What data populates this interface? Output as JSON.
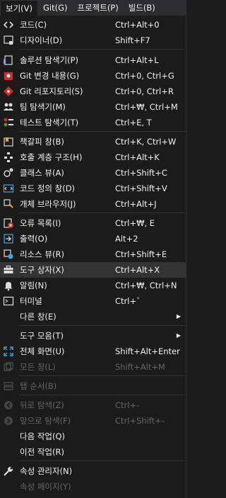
{
  "menubar": [
    "보기(V)",
    "Git(G)",
    "프로젝트(P)",
    "빌드(B)"
  ],
  "items": [
    {
      "label": "코드(C)",
      "shortcut": "Ctrl+Alt+0",
      "icon": "code-icon"
    },
    {
      "label": "디자이너(D)",
      "shortcut": "Shift+F7",
      "icon": "designer-icon"
    },
    {
      "label": "솔루션 탐색기(P)",
      "shortcut": "Ctrl+Alt+L",
      "icon": "solution-explorer-icon"
    },
    {
      "label": "Git 변경 내용(G)",
      "shortcut": "Ctrl+0, Ctrl+G",
      "icon": "git-changes-icon"
    },
    {
      "label": "Git 리포지토리(S)",
      "shortcut": "Ctrl+0, Ctrl+R",
      "icon": "git-repository-icon"
    },
    {
      "label": "팀 탐색기(M)",
      "shortcut": "Ctrl+₩, Ctrl+M",
      "icon": "team-explorer-icon"
    },
    {
      "label": "테스트 탐색기(T)",
      "shortcut": "Ctrl+E, T",
      "icon": "test-explorer-icon"
    },
    {
      "label": "책갈피 창(B)",
      "shortcut": "Ctrl+K, Ctrl+W",
      "icon": "bookmark-icon"
    },
    {
      "label": "호출 계층 구조(H)",
      "shortcut": "Ctrl+Alt+K",
      "icon": "call-hierarchy-icon"
    },
    {
      "label": "클래스 뷰(A)",
      "shortcut": "Ctrl+Shift+C",
      "icon": "class-view-icon"
    },
    {
      "label": "코드 정의 창(D)",
      "shortcut": "Ctrl+Shift+V",
      "icon": "code-definition-icon"
    },
    {
      "label": "개체 브라우저(J)",
      "shortcut": "Ctrl+Alt+J",
      "icon": "object-browser-icon"
    },
    {
      "label": "오류 목록(I)",
      "shortcut": "Ctrl+₩, E",
      "icon": "error-list-icon"
    },
    {
      "label": "출력(O)",
      "shortcut": "Alt+2",
      "icon": "output-icon"
    },
    {
      "label": "리소스 뷰(R)",
      "shortcut": "Ctrl+Shift+E",
      "icon": "resource-view-icon"
    },
    {
      "label": "도구 상자(X)",
      "shortcut": "Ctrl+Alt+X",
      "icon": "toolbox-icon"
    },
    {
      "label": "알림(N)",
      "shortcut": "Ctrl+₩, Ctrl+N",
      "icon": "bell-icon"
    },
    {
      "label": "터미널",
      "shortcut": "Ctrl+`",
      "icon": "terminal-icon"
    },
    {
      "label": "다른 창(E)",
      "shortcut": "",
      "icon": ""
    },
    {
      "label": "도구 모음(T)",
      "shortcut": "",
      "icon": ""
    },
    {
      "label": "전체 화면(U)",
      "shortcut": "Shift+Alt+Enter",
      "icon": "fullscreen-icon"
    },
    {
      "label": "모든 창(L)",
      "shortcut": "Shift+Alt+M",
      "icon": "all-windows-icon"
    },
    {
      "label": "탭 순서(B)",
      "shortcut": "",
      "icon": "tab-order-icon"
    },
    {
      "label": "뒤로 탐색(Z)",
      "shortcut": "Ctrl+-",
      "icon": "navigate-back-icon"
    },
    {
      "label": "앞으로 탐색(F)",
      "shortcut": "Ctrl+Shift+-",
      "icon": "navigate-forward-icon"
    },
    {
      "label": "다음 작업(Q)",
      "shortcut": "",
      "icon": ""
    },
    {
      "label": "이전 작업(R)",
      "shortcut": "",
      "icon": ""
    },
    {
      "label": "속성 관리자(N)",
      "shortcut": "",
      "icon": "wrench-icon"
    },
    {
      "label": "속성 페이지(Y)",
      "shortcut": "",
      "icon": ""
    }
  ],
  "colors": {
    "background": "#1b1b1c",
    "highlight": "#333334",
    "text": "#f1f1f1",
    "disabled": "#656565",
    "separator": "#333337"
  }
}
